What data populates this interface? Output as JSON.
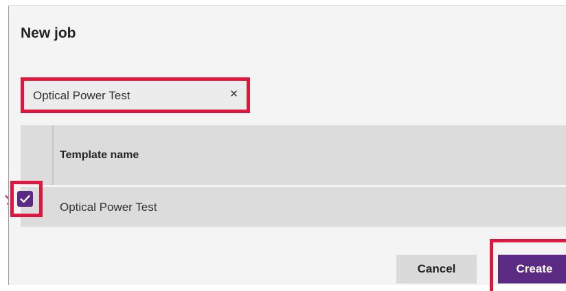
{
  "dialog": {
    "title": "New job"
  },
  "search": {
    "value": "Optical Power Test",
    "clear_icon": "×"
  },
  "table": {
    "column_header": "Template name",
    "rows": [
      {
        "name": "Optical Power Test",
        "checked": true
      }
    ]
  },
  "actions": {
    "cancel_label": "Cancel",
    "create_label": "Create"
  },
  "colors": {
    "accent": "#5b2a82",
    "highlight": "#e0163f"
  }
}
